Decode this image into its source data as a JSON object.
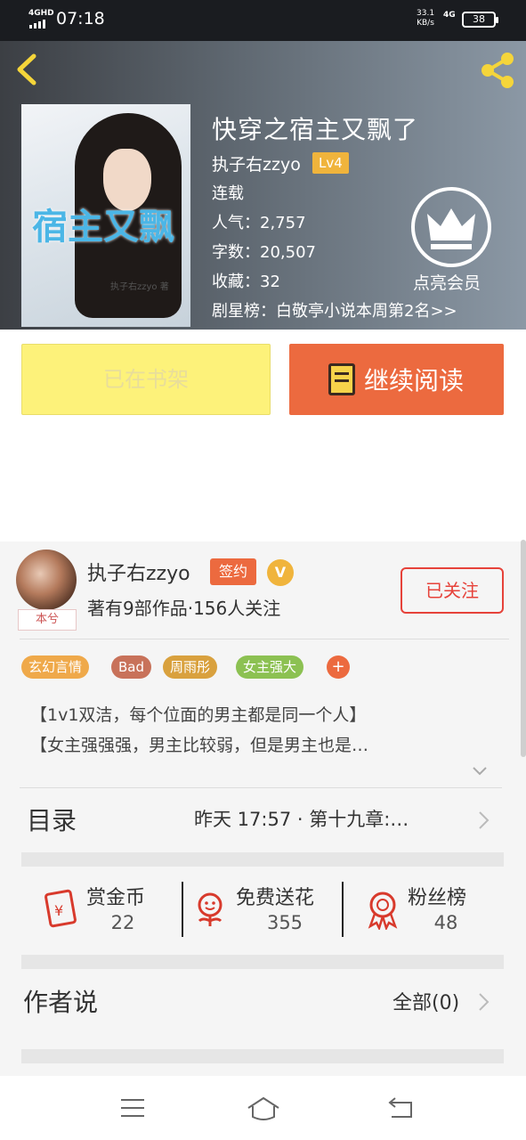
{
  "status_bar": {
    "network": "4GHD",
    "time": "07:18",
    "speed_value": "33.1",
    "speed_unit": "KB/s",
    "lte": "4G",
    "battery": "38"
  },
  "book": {
    "title": "快穿之宿主又飘了",
    "author": "执子右zzyo",
    "level": "Lv4",
    "status": "连载",
    "popularity": "人气：2,757",
    "word_count": "字数：20,507",
    "favorites": "收藏：32",
    "ranking": "剧星榜：白敬亭小说本周第2名>>",
    "cover_title": "宿主又飘",
    "cover_author": "执子右zzyo 著"
  },
  "vip": {
    "label": "点亮会员",
    "icon": "crown-icon"
  },
  "actions": {
    "shelf_label": "已在书架",
    "read_label": "继续阅读"
  },
  "author_card": {
    "name": "执子右zzyo",
    "signed": "签约",
    "v_badge": "V",
    "avatar_tag": "本兮",
    "stats": "著有9部作品·156人关注",
    "follow_label": "已关注"
  },
  "tags": [
    {
      "label": "玄幻言情",
      "color": "#efa94a"
    },
    {
      "label": "Bad",
      "color": "#c8725a"
    },
    {
      "label": "周雨彤",
      "color": "#d9a13e"
    },
    {
      "label": "女主强大",
      "color": "#8cc152"
    }
  ],
  "tag_more": "+",
  "description": {
    "line1": "【1v1双洁，每个位面的男主都是同一个人】",
    "line2": "【女主强强强，男主比较弱，但是男主也是…"
  },
  "catalog": {
    "title": "目录",
    "latest": "昨天 17:57 · 第十九章:…"
  },
  "stats": [
    {
      "label": "赏金币",
      "value": "22",
      "icon": "red-envelope-icon"
    },
    {
      "label": "免费送花",
      "value": "355",
      "icon": "flower-icon"
    },
    {
      "label": "粉丝榜",
      "value": "48",
      "icon": "medal-icon"
    }
  ],
  "author_says": {
    "title": "作者说",
    "all": "全部(0)"
  },
  "colors": {
    "accent": "#ec6a3f",
    "follow_red": "#e6423a",
    "shelf_yellow": "#fdf27a",
    "level_gold": "#f0b43c"
  }
}
